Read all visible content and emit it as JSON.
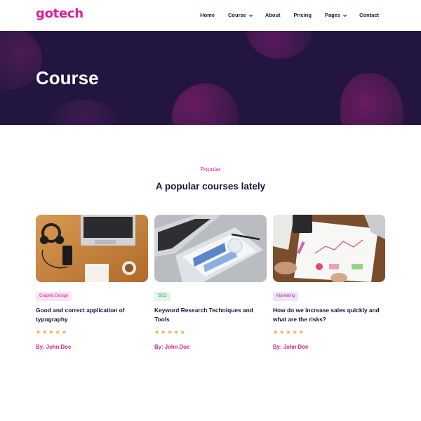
{
  "brand": {
    "logo": "gotech",
    "accent": "#d6219c",
    "dark": "#221540"
  },
  "nav": [
    {
      "label": "Home",
      "dropdown": false
    },
    {
      "label": "Course",
      "dropdown": true
    },
    {
      "label": "About",
      "dropdown": false
    },
    {
      "label": "Pricing",
      "dropdown": false
    },
    {
      "label": "Pages",
      "dropdown": true
    },
    {
      "label": "Contact",
      "dropdown": false
    }
  ],
  "hero": {
    "title": "Course"
  },
  "section": {
    "eyebrow": "Popular",
    "title": "A popular courses lately"
  },
  "courses": [
    {
      "tag": "Graphic Design",
      "title": "Good and correct application of typography",
      "rating": 5,
      "author": "By: John Doe",
      "image": "desk-headphones-laptop"
    },
    {
      "tag": "SEO",
      "title": "Keyword Research Techniques and Tools",
      "rating": 5,
      "author": "By: John Doe",
      "image": "laptop-tablet-chart"
    },
    {
      "tag": "Marketing",
      "title": "How do we increase sales quickly and what are the risks?",
      "rating": 5,
      "author": "By: John Doe",
      "image": "desk-documents-charts"
    }
  ]
}
